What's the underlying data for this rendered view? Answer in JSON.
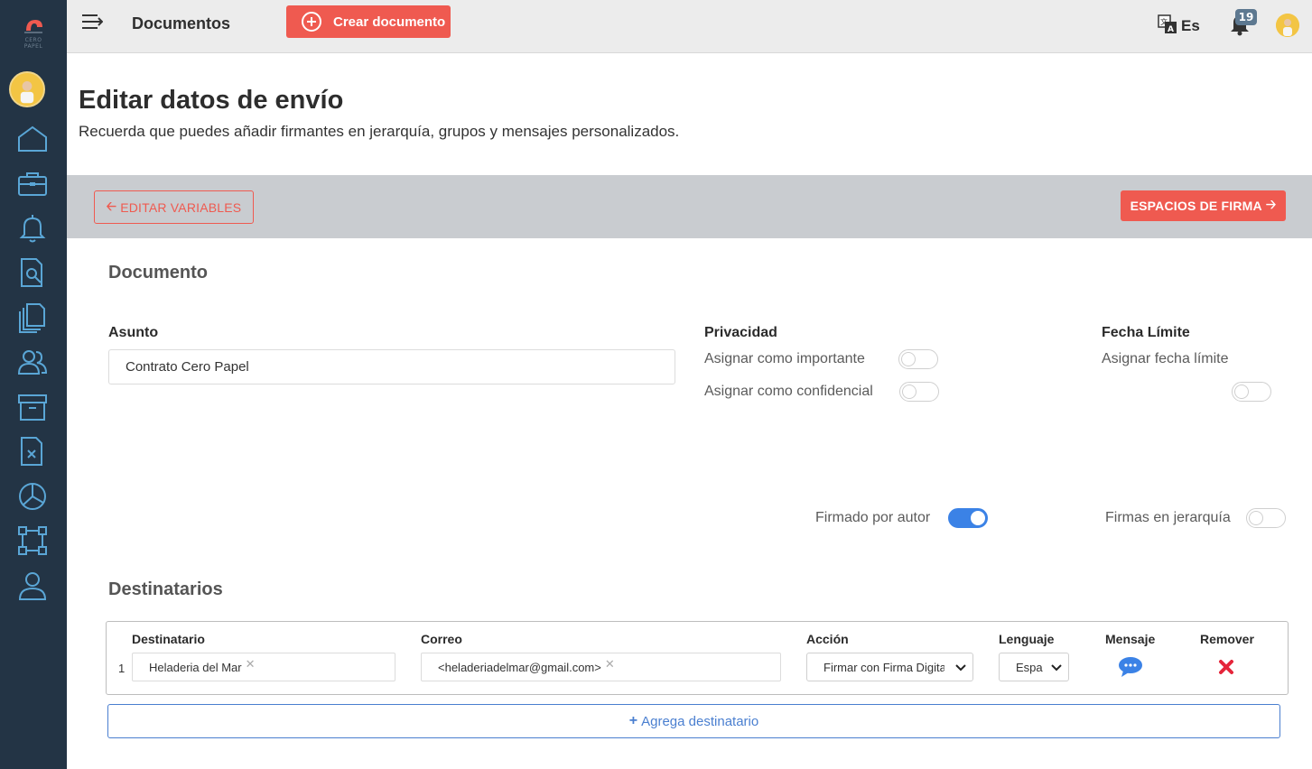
{
  "app": {
    "logo_text": "CERO PAPEL",
    "brand_color": "#ef5a50",
    "sidebar_color": "#233445",
    "toggle_on_color": "#3b82e6"
  },
  "sidebar": {
    "items": [
      {
        "name": "home-icon"
      },
      {
        "name": "briefcase-icon"
      },
      {
        "name": "bell-icon"
      },
      {
        "name": "document-search-icon"
      },
      {
        "name": "documents-copy-icon"
      },
      {
        "name": "users-icon"
      },
      {
        "name": "archive-icon"
      },
      {
        "name": "document-x-icon"
      },
      {
        "name": "pie-chart-icon"
      },
      {
        "name": "workflow-icon"
      },
      {
        "name": "user-icon"
      }
    ]
  },
  "topbar": {
    "title": "Documentos",
    "create_label": "Crear documento",
    "lang_label": "Es",
    "notifications_count": "19"
  },
  "page": {
    "title": "Editar datos de envío",
    "subtitle": "Recuerda que puedes añadir firmantes en jerarquía, grupos y mensajes personalizados."
  },
  "actions": {
    "edit_variables": "EDITAR VARIABLES",
    "signature_spaces": "ESPACIOS DE FIRMA"
  },
  "document": {
    "heading": "Documento",
    "subject_label": "Asunto",
    "subject_value": "Contrato Cero Papel",
    "privacy_label": "Privacidad",
    "important_label": "Asignar como importante",
    "important_on": false,
    "confidential_label": "Asignar como confidencial",
    "confidential_on": false,
    "deadline_label": "Fecha Límite",
    "deadline_assign_label": "Asignar fecha límite",
    "deadline_on": false,
    "signed_by_author_label": "Firmado por autor",
    "signed_by_author_on": true,
    "hierarchy_label": "Firmas en jerarquía",
    "hierarchy_on": false
  },
  "recipients": {
    "heading": "Destinatarios",
    "columns": {
      "recipient": "Destinatario",
      "email": "Correo",
      "action": "Acción",
      "language": "Lenguaje",
      "message": "Mensaje",
      "remove": "Remover"
    },
    "rows": [
      {
        "index": "1",
        "recipient": "Heladeria del Mar",
        "email": "<heladeriadelmar@gmail.com>",
        "action": "Firmar con Firma Digital",
        "language": "Español"
      }
    ],
    "add_label": "Agrega destinatario"
  }
}
